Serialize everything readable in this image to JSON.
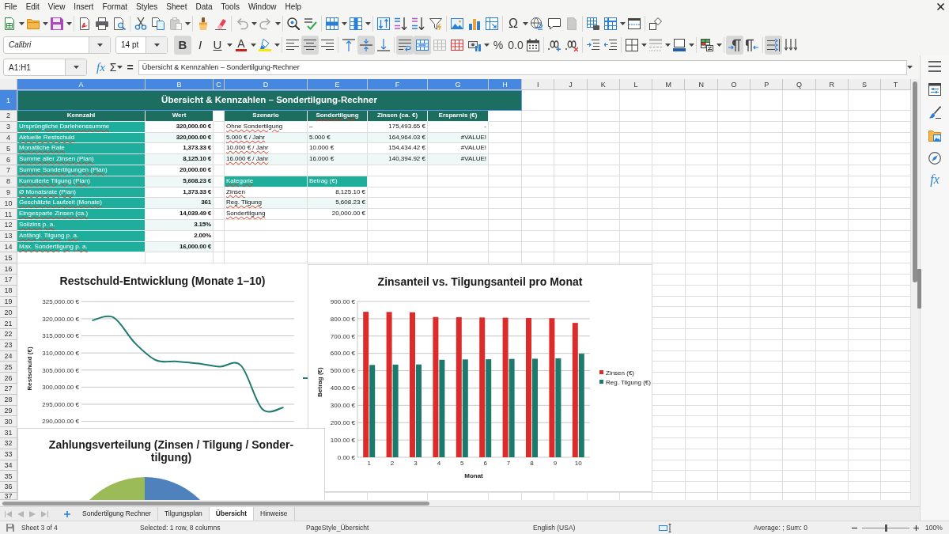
{
  "menu_bar": {
    "items": [
      "File",
      "Edit",
      "View",
      "Insert",
      "Format",
      "Styles",
      "Sheet",
      "Data",
      "Tools",
      "Window",
      "Help"
    ]
  },
  "standard_toolbar": {
    "paste": {
      "disabled": true
    },
    "undo": {
      "disabled": true
    },
    "redo": {
      "disabled": true
    },
    "special_character": {
      "label": "Ω"
    },
    "page_button": {
      "disabled": true
    }
  },
  "formatting_toolbar": {
    "font_name": "Calibri",
    "font_size": "14 pt",
    "bold": {
      "label": "B",
      "on": true
    },
    "italic": {
      "label": "I",
      "on": false
    },
    "underline": {
      "label": "U",
      "on": false
    },
    "font_color": {
      "label": "A"
    },
    "align_left": {
      "on": false
    },
    "align_center": {
      "on": true
    },
    "align_right": {
      "on": false
    },
    "align_top": {
      "on": false
    },
    "align_middle": {
      "on": true
    },
    "align_bottom": {
      "on": false
    },
    "wrap_text": {
      "on": true
    },
    "merge_and_center": {
      "on": true
    },
    "merge_cells": {
      "disabled": true
    },
    "percent": {
      "label": "%"
    },
    "decimal_format": {
      "label": "0.0"
    },
    "border_style": {
      "disabled": true
    },
    "left_to_right": {
      "on": true
    },
    "right_to_left": {
      "on": false
    },
    "text_direction": {
      "on": true
    }
  },
  "formula_bar": {
    "name_box": "A1:H1",
    "function_wizard": "fx",
    "sum": "Σ",
    "equals": "=",
    "content": "Übersicht & Kennzahlen – Sondertilgung-Rechner"
  },
  "sheet": {
    "column_headers": [
      {
        "label": "A",
        "selected": true
      },
      {
        "label": "B",
        "selected": true
      },
      {
        "label": "C",
        "selected": true
      },
      {
        "label": "D",
        "selected": true
      },
      {
        "label": "E",
        "selected": true
      },
      {
        "label": "F",
        "selected": true
      },
      {
        "label": "G",
        "selected": true
      },
      {
        "label": "H",
        "selected": true
      },
      {
        "label": "I",
        "selected": false
      },
      {
        "label": "J",
        "selected": false
      },
      {
        "label": "K",
        "selected": false
      },
      {
        "label": "L",
        "selected": false
      },
      {
        "label": "M",
        "selected": false
      },
      {
        "label": "N",
        "selected": false
      },
      {
        "label": "O",
        "selected": false
      },
      {
        "label": "P",
        "selected": false
      },
      {
        "label": "Q",
        "selected": false
      },
      {
        "label": "R",
        "selected": false
      },
      {
        "label": "S",
        "selected": false
      },
      {
        "label": "T",
        "selected": false
      }
    ],
    "row_headers": [
      {
        "label": "1",
        "selected": true
      },
      {
        "label": "2",
        "selected": false
      },
      {
        "label": "3",
        "selected": false
      },
      {
        "label": "4",
        "selected": false
      },
      {
        "label": "5",
        "selected": false
      },
      {
        "label": "6",
        "selected": false
      },
      {
        "label": "7",
        "selected": false
      },
      {
        "label": "8",
        "selected": false
      },
      {
        "label": "9",
        "selected": false
      },
      {
        "label": "10",
        "selected": false
      },
      {
        "label": "11",
        "selected": false
      },
      {
        "label": "12",
        "selected": false
      },
      {
        "label": "13",
        "selected": false
      },
      {
        "label": "14",
        "selected": false
      },
      {
        "label": "15",
        "selected": false
      },
      {
        "label": "16",
        "selected": false
      },
      {
        "label": "17",
        "selected": false
      },
      {
        "label": "18",
        "selected": false
      },
      {
        "label": "19",
        "selected": false
      },
      {
        "label": "20",
        "selected": false
      },
      {
        "label": "21",
        "selected": false
      },
      {
        "label": "22",
        "selected": false
      },
      {
        "label": "23",
        "selected": false
      },
      {
        "label": "24",
        "selected": false
      },
      {
        "label": "25",
        "selected": false
      },
      {
        "label": "26",
        "selected": false
      },
      {
        "label": "27",
        "selected": false
      },
      {
        "label": "28",
        "selected": false
      },
      {
        "label": "29",
        "selected": false
      },
      {
        "label": "30",
        "selected": false
      },
      {
        "label": "31",
        "selected": false
      },
      {
        "label": "32",
        "selected": false
      },
      {
        "label": "33",
        "selected": false
      },
      {
        "label": "34",
        "selected": false
      },
      {
        "label": "35",
        "selected": false
      },
      {
        "label": "36",
        "selected": false
      },
      {
        "label": "37",
        "selected": false
      }
    ],
    "title": {
      "text": "Übersicht & Kennzahlen – Sondertilgung-Rechner",
      "selected": true
    },
    "key_figures": {
      "columns": [
        {
          "text": "Kennzahl",
          "misspelled": false
        },
        {
          "text": "Wert",
          "misspelled": false
        }
      ],
      "rows": [
        {
          "label": "Ursprüngliche Darlehenssumme",
          "misspelled": true,
          "value": "320,000.00 €"
        },
        {
          "label": "Aktuelle Restschuld",
          "misspelled": true,
          "value": "320,000.00 €"
        },
        {
          "label": "Monatliche Rate",
          "misspelled": true,
          "value": "1,373.33 €"
        },
        {
          "label": "Summe aller Zinsen (Plan)",
          "misspelled": true,
          "value": "8,125.10 €"
        },
        {
          "label": "Summe Sondertilgungen (Plan)",
          "misspelled": true,
          "value": "20,000.00 €"
        },
        {
          "label": "Kumulierte Tilgung (Plan)",
          "misspelled": true,
          "value": "5,608.23 €"
        },
        {
          "label": "Ø Monatsrate (Plan)",
          "misspelled": true,
          "value": "1,373.33 €"
        },
        {
          "label": "Geschätzte Laufzeit (Monate)",
          "misspelled": true,
          "value": "361"
        },
        {
          "label": "Eingesparte Zinsen (ca.)",
          "misspelled": true,
          "value": "14,039.49 €"
        },
        {
          "label": "Sollzins p. a.",
          "misspelled": true,
          "value": "3.15%"
        },
        {
          "label": "Anfängl. Tilgung p. a.",
          "misspelled": true,
          "value": "2.00%"
        },
        {
          "label": "Max. Sondertilgung p. a.",
          "misspelled": true,
          "value": "16,000.00 €"
        }
      ]
    },
    "scenarios": {
      "columns": [
        {
          "text": "Szenario",
          "misspelled": false
        },
        {
          "text": "Sondertilgung",
          "misspelled": true
        },
        {
          "text": "Zinsen (ca. €)",
          "misspelled": false
        },
        {
          "text": "Ersparnis (€)",
          "misspelled": false
        }
      ],
      "rows": [
        {
          "scenario": "Ohne Sondertilgung",
          "misspelled": true,
          "extra_payment": "–",
          "interest": "175,493.65 €",
          "savings": "-"
        },
        {
          "scenario": "5.000 € / Jahr",
          "misspelled": true,
          "extra_payment": "5.000 €",
          "interest": "164,964.03 €",
          "savings": "#VALUE!"
        },
        {
          "scenario": "10.000 € / Jahr",
          "misspelled": true,
          "extra_payment": "10.000 €",
          "interest": "154,434.42 €",
          "savings": "#VALUE!"
        },
        {
          "scenario": "16.000 € / Jahr",
          "misspelled": true,
          "extra_payment": "16.000 €",
          "interest": "140,394.92 €",
          "savings": "#VALUE!"
        }
      ]
    },
    "categories": {
      "columns": [
        {
          "text": "Kategorie",
          "misspelled": true
        },
        {
          "text": "Betrag (€)",
          "misspelled": false
        }
      ],
      "rows": [
        {
          "category": "Zinsen",
          "misspelled": true,
          "amount": "8,125.10 €"
        },
        {
          "category": "Reg. Tilgung",
          "misspelled": true,
          "amount": "5,608.23 €"
        },
        {
          "category": "Sondertilgung",
          "misspelled": true,
          "amount": "20,000.00 €"
        }
      ]
    }
  },
  "charts": [
    {
      "chart_data": {
        "type": "line",
        "title": "Restschuld-Entwicklung (Monate 1–10)",
        "ylabel": "Restschuld (€)",
        "ylim": [
          290000,
          325000
        ],
        "grid": true,
        "yticks": [
          {
            "value": 290000,
            "label": "290,000.00 €"
          },
          {
            "value": 295000,
            "label": "295,000.00 €"
          },
          {
            "value": 300000,
            "label": "300,000.00 €"
          },
          {
            "value": 305000,
            "label": "305,000.00 €"
          },
          {
            "value": 310000,
            "label": "310,000.00 €"
          },
          {
            "value": 315000,
            "label": "315,000.00 €"
          },
          {
            "value": 320000,
            "label": "320,000.00 €"
          },
          {
            "value": 325000,
            "label": "325,000.00 €"
          }
        ],
        "series": [
          {
            "color": "#1e7b6e",
            "values": [
              319500,
              320400,
              313000,
              307900,
              307500,
              306900,
              306000,
              306300,
              293600,
              294100
            ]
          }
        ]
      }
    },
    {
      "chart_data": {
        "type": "bar",
        "title": "Zinsanteil vs. Tilgungsanteil pro Monat",
        "xlabel": "Monat",
        "ylabel": "Betrag (€)",
        "categories": [
          "1",
          "2",
          "3",
          "4",
          "5",
          "6",
          "7",
          "8",
          "9",
          "10"
        ],
        "ylim": [
          0,
          900
        ],
        "grid": true,
        "legend": "right",
        "yticks": [
          {
            "value": 0,
            "label": "0.00 €"
          },
          {
            "value": 100,
            "label": "100.00 €"
          },
          {
            "value": 200,
            "label": "200.00 €"
          },
          {
            "value": 300,
            "label": "300.00 €"
          },
          {
            "value": 400,
            "label": "400.00 €"
          },
          {
            "value": 500,
            "label": "500.00 €"
          },
          {
            "value": 600,
            "label": "600.00 €"
          },
          {
            "value": 700,
            "label": "700.00 €"
          },
          {
            "value": 800,
            "label": "800.00 €"
          },
          {
            "value": 900,
            "label": "900.00 €"
          }
        ],
        "series": [
          {
            "name": "Zinsen (€)",
            "color": "#dc2b2b",
            "values": [
              840,
              839,
              837,
              810,
              809,
              807,
              806,
              804,
              803,
              776
            ]
          },
          {
            "name": "Reg. Tilgung (€)",
            "color": "#1b7a6c",
            "values": [
              533,
              535,
              536,
              563,
              565,
              566,
              568,
              569,
              571,
              598
            ]
          }
        ]
      }
    }
  ],
  "pie_chart": {
    "title": "Zahlungsverteilung (Zinsen / Tilgung / Sonder-tilgung)"
  },
  "sidebar": {
    "functions": {
      "label": "fx"
    }
  },
  "sheet_tabs": {
    "tabs": [
      {
        "label": "Sondertilgung Rechner",
        "selected": false
      },
      {
        "label": "Tilgungsplan",
        "selected": false
      },
      {
        "label": "Übersicht",
        "selected": true
      },
      {
        "label": "Hinweise",
        "selected": false
      }
    ]
  },
  "status_bar": {
    "sheet": "Sheet 3 of 4",
    "selection": "Selected: 1 row, 8 columns",
    "page_style": "PageStyle_Übersicht",
    "language": "English (USA)",
    "summary": "Average: ; Sum: 0",
    "zoom": {
      "level": 0.5,
      "reading": "100%"
    }
  }
}
